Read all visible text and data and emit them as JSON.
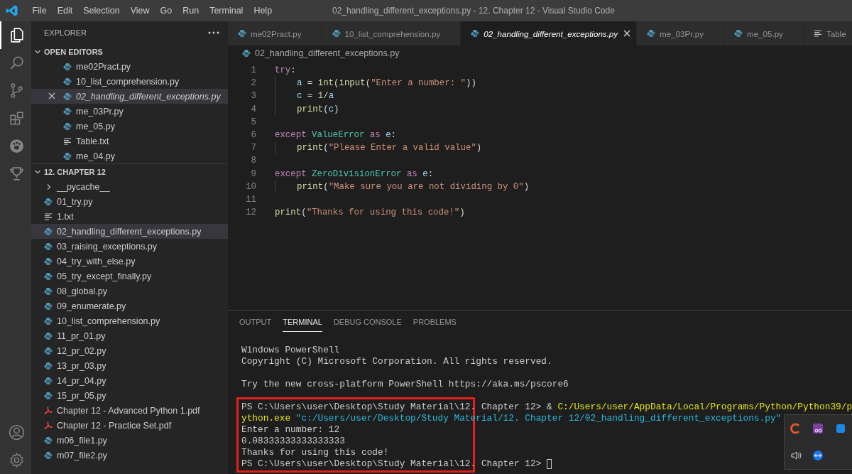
{
  "window": {
    "title": "02_handling_different_exceptions.py - 12. Chapter 12 - Visual Studio Code"
  },
  "menu": [
    "File",
    "Edit",
    "Selection",
    "View",
    "Go",
    "Run",
    "Terminal",
    "Help"
  ],
  "activity_bar": [
    {
      "kind": "files",
      "selected": true
    },
    {
      "kind": "search",
      "selected": false
    },
    {
      "kind": "branch",
      "selected": false
    },
    {
      "kind": "extensions",
      "selected": false
    },
    {
      "kind": "paw",
      "selected": false
    },
    {
      "kind": "trophy",
      "selected": false
    }
  ],
  "activity_bar_bottom": [
    {
      "kind": "account"
    },
    {
      "kind": "settings"
    }
  ],
  "sidebar": {
    "title": "EXPLORER",
    "sections": [
      {
        "title": "OPEN EDITORS",
        "expanded": true,
        "items": [
          {
            "name": "me02Pract.py",
            "kind": "python",
            "selected": false,
            "preview": false
          },
          {
            "name": "10_list_comprehension.py",
            "kind": "python",
            "selected": false,
            "preview": false
          },
          {
            "name": "02_handling_different_exceptions.py",
            "kind": "python",
            "selected": true,
            "preview": true
          },
          {
            "name": "me_03Pr.py",
            "kind": "python",
            "selected": false,
            "preview": false
          },
          {
            "name": "me_05.py",
            "kind": "python",
            "selected": false,
            "preview": false
          },
          {
            "name": "Table.txt",
            "kind": "text",
            "selected": false,
            "preview": false
          },
          {
            "name": "me_04.py",
            "kind": "python",
            "selected": false,
            "preview": false
          }
        ]
      },
      {
        "title": "12. CHAPTER 12",
        "expanded": true,
        "items": [
          {
            "name": "__pycache__",
            "kind": "folder",
            "expanded": false,
            "selected": false
          },
          {
            "name": "01_try.py",
            "kind": "python",
            "selected": false
          },
          {
            "name": "1.txt",
            "kind": "text",
            "selected": false
          },
          {
            "name": "02_handling_different_exceptions.py",
            "kind": "python",
            "selected": true
          },
          {
            "name": "03_raising_exceptions.py",
            "kind": "python",
            "selected": false
          },
          {
            "name": "04_try_with_else.py",
            "kind": "python",
            "selected": false
          },
          {
            "name": "05_try_except_finally.py",
            "kind": "python",
            "selected": false
          },
          {
            "name": "08_global.py",
            "kind": "python",
            "selected": false
          },
          {
            "name": "09_enumerate.py",
            "kind": "python",
            "selected": false
          },
          {
            "name": "10_list_comprehension.py",
            "kind": "python",
            "selected": false
          },
          {
            "name": "11_pr_01.py",
            "kind": "python",
            "selected": false
          },
          {
            "name": "12_pr_02.py",
            "kind": "python",
            "selected": false
          },
          {
            "name": "13_pr_03.py",
            "kind": "python",
            "selected": false
          },
          {
            "name": "14_pr_04.py",
            "kind": "python",
            "selected": false
          },
          {
            "name": "15_pr_05.py",
            "kind": "python",
            "selected": false
          },
          {
            "name": "Chapter 12 - Advanced Python 1.pdf",
            "kind": "pdf",
            "selected": false
          },
          {
            "name": "Chapter 12 - Practice Set.pdf",
            "kind": "pdf",
            "selected": false
          },
          {
            "name": "m06_file1.py",
            "kind": "python",
            "selected": false
          },
          {
            "name": "m07_file2.py",
            "kind": "python",
            "selected": false
          }
        ]
      }
    ]
  },
  "tabs": [
    {
      "label": "me02Pract.py",
      "kind": "python",
      "selected": false,
      "preview": false
    },
    {
      "label": "10_list_comprehension.py",
      "kind": "python",
      "selected": false,
      "preview": false
    },
    {
      "label": "02_handling_different_exceptions.py",
      "kind": "python",
      "selected": true,
      "preview": true
    },
    {
      "label": "me_03Pr.py",
      "kind": "python",
      "selected": false,
      "preview": false
    },
    {
      "label": "me_05.py",
      "kind": "python",
      "selected": false,
      "preview": false
    },
    {
      "label": "Table",
      "kind": "text",
      "selected": false,
      "preview": false
    }
  ],
  "breadcrumb": {
    "label": "02_handling_different_exceptions.py",
    "kind": "python"
  },
  "code": [
    {
      "number": "1",
      "indented": false,
      "tokens": [
        {
          "kind": "keyword",
          "text": "try"
        },
        {
          "kind": "plain",
          "text": ":"
        }
      ]
    },
    {
      "number": "2",
      "indented": true,
      "tokens": [
        {
          "kind": "var",
          "text": "a"
        },
        {
          "kind": "plain",
          "text": " = "
        },
        {
          "kind": "func",
          "text": "int"
        },
        {
          "kind": "plain",
          "text": "("
        },
        {
          "kind": "func",
          "text": "input"
        },
        {
          "kind": "plain",
          "text": "("
        },
        {
          "kind": "string",
          "text": "\"Enter a number: \""
        },
        {
          "kind": "plain",
          "text": "))"
        }
      ]
    },
    {
      "number": "3",
      "indented": true,
      "tokens": [
        {
          "kind": "var",
          "text": "c"
        },
        {
          "kind": "plain",
          "text": " = "
        },
        {
          "kind": "number",
          "text": "1"
        },
        {
          "kind": "plain",
          "text": "/"
        },
        {
          "kind": "var",
          "text": "a"
        }
      ]
    },
    {
      "number": "4",
      "indented": true,
      "tokens": [
        {
          "kind": "func",
          "text": "print"
        },
        {
          "kind": "plain",
          "text": "("
        },
        {
          "kind": "var",
          "text": "c"
        },
        {
          "kind": "plain",
          "text": ")"
        }
      ]
    },
    {
      "number": "5",
      "indented": false
    },
    {
      "number": "6",
      "indented": false,
      "tokens": [
        {
          "kind": "keyword",
          "text": "except "
        },
        {
          "kind": "class",
          "text": "ValueError "
        },
        {
          "kind": "keyword",
          "text": "as "
        },
        {
          "kind": "var",
          "text": "e"
        },
        {
          "kind": "plain",
          "text": ":"
        }
      ]
    },
    {
      "number": "7",
      "indented": true,
      "tokens": [
        {
          "kind": "func",
          "text": "print"
        },
        {
          "kind": "plain",
          "text": "("
        },
        {
          "kind": "string",
          "text": "\"Please Enter a valid value\""
        },
        {
          "kind": "plain",
          "text": ")"
        }
      ]
    },
    {
      "number": "8",
      "indented": false
    },
    {
      "number": "9",
      "indented": false,
      "tokens": [
        {
          "kind": "keyword",
          "text": "except "
        },
        {
          "kind": "class",
          "text": "ZeroDivisionError "
        },
        {
          "kind": "keyword",
          "text": "as "
        },
        {
          "kind": "var",
          "text": "e"
        },
        {
          "kind": "plain",
          "text": ":"
        }
      ]
    },
    {
      "number": "10",
      "indented": true,
      "tokens": [
        {
          "kind": "func",
          "text": "print"
        },
        {
          "kind": "plain",
          "text": "("
        },
        {
          "kind": "string",
          "text": "\"Make sure you are not dividing by 0\""
        },
        {
          "kind": "plain",
          "text": ")"
        }
      ]
    },
    {
      "number": "11",
      "indented": false
    },
    {
      "number": "12",
      "indented": false,
      "tokens": [
        {
          "kind": "func",
          "text": "print"
        },
        {
          "kind": "plain",
          "text": "("
        },
        {
          "kind": "string",
          "text": "\"Thanks for using this code!\""
        },
        {
          "kind": "plain",
          "text": ")"
        }
      ]
    }
  ],
  "panel_tabs": [
    {
      "label": "OUTPUT",
      "selected": false
    },
    {
      "label": "TERMINAL",
      "selected": true
    },
    {
      "label": "DEBUG CONSOLE",
      "selected": false
    },
    {
      "label": "PROBLEMS",
      "selected": false
    }
  ],
  "terminal_blocks": [
    {
      "framed": false,
      "lines": [
        {
          "kind": "text",
          "tokens": [
            {
              "kind": "plain",
              "text": "Windows PowerShell"
            }
          ]
        },
        {
          "kind": "text",
          "tokens": [
            {
              "kind": "plain",
              "text": "Copyright (C) Microsoft Corporation. All rights reserved."
            }
          ]
        },
        {
          "kind": "blank"
        },
        {
          "kind": "text",
          "tokens": [
            {
              "kind": "plain",
              "text": "Try the new cross-platform PowerShell https://aka.ms/pscore6"
            }
          ]
        },
        {
          "kind": "blank"
        }
      ]
    },
    {
      "framed": true,
      "color": "#e0201c",
      "lines": [
        {
          "tokens": [
            {
              "kind": "plain",
              "text": "PS C:\\Users\\user\\Desktop\\Study Material\\12. Chapter 12> & "
            },
            {
              "kind": "command",
              "text": "C:/Users/user/AppData/Local/Programs/Python/Python39/p"
            }
          ]
        },
        {
          "tokens": [
            {
              "kind": "command",
              "text": "ython.exe "
            },
            {
              "kind": "string",
              "text": "\"c:/Users/user/Desktop/Study Material/12. Chapter 12/02_handling_different_exceptions.py\""
            }
          ]
        },
        {
          "tokens": [
            {
              "kind": "plain",
              "text": "Enter a number: 12"
            }
          ]
        },
        {
          "tokens": [
            {
              "kind": "plain",
              "text": "0.08333333333333333"
            }
          ]
        },
        {
          "tokens": [
            {
              "kind": "plain",
              "text": "Thanks for using this code!"
            }
          ]
        },
        {
          "cursor": true,
          "tokens": [
            {
              "kind": "plain",
              "text": "PS C:\\Users\\user\\Desktop\\Study Material\\12. Chapter 12> "
            }
          ]
        }
      ]
    }
  ]
}
